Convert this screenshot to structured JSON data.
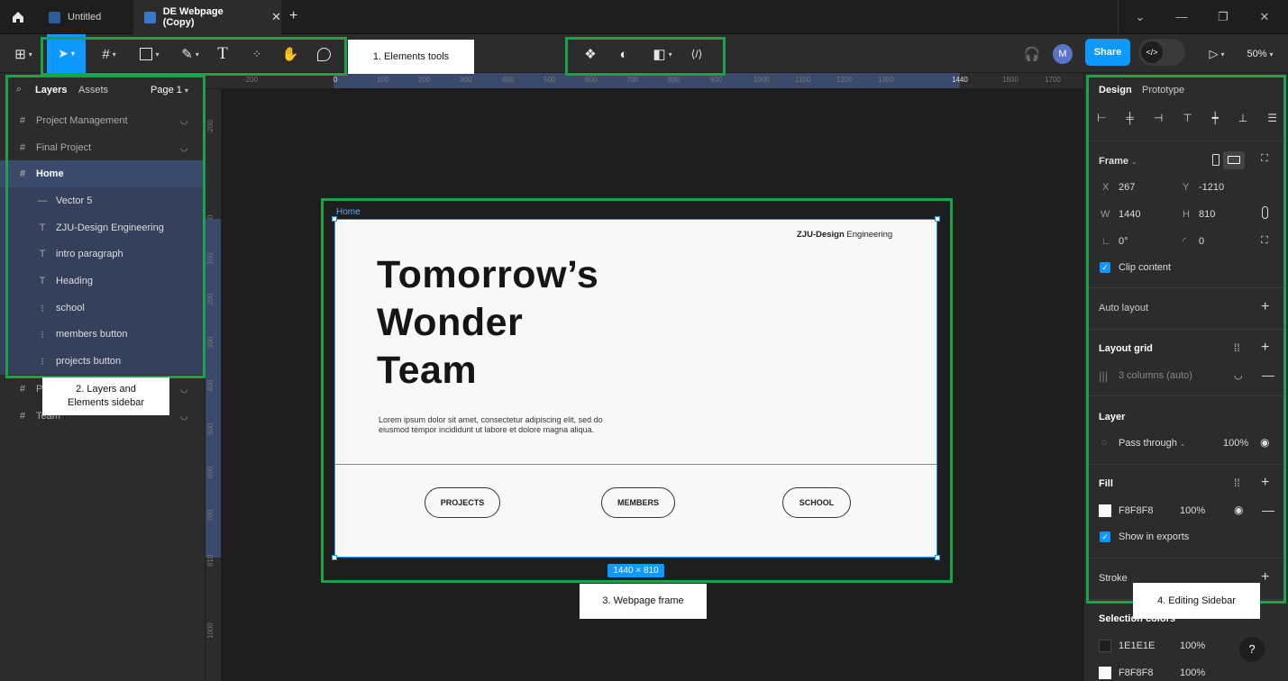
{
  "tabs": [
    {
      "label": "Untitled"
    },
    {
      "label": "DE Webpage (Copy)"
    }
  ],
  "toolbar": {
    "share": "Share",
    "zoom": "50%",
    "avatar_initial": "M",
    "text_tool": "T"
  },
  "left": {
    "tab_layers": "Layers",
    "tab_assets": "Assets",
    "page": "Page 1",
    "layers": [
      {
        "label": "Project Management",
        "icon": "#"
      },
      {
        "label": "Final Project",
        "icon": "#"
      },
      {
        "label": "Home",
        "icon": "#"
      },
      {
        "label": "Vector 5",
        "icon": "—"
      },
      {
        "label": "ZJU-Design Engineering",
        "icon": "T"
      },
      {
        "label": "intro paragraph",
        "icon": "T"
      },
      {
        "label": "Heading",
        "icon": "T"
      },
      {
        "label": "school",
        "icon": "⁝"
      },
      {
        "label": "members button",
        "icon": "⁝"
      },
      {
        "label": "projects button",
        "icon": "⁝"
      },
      {
        "label": "P",
        "icon": "#"
      },
      {
        "label": "Team",
        "icon": "#"
      }
    ]
  },
  "ruler": {
    "top": [
      "-200",
      "0",
      "100",
      "200",
      "300",
      "400",
      "500",
      "600",
      "700",
      "800",
      "900",
      "1000",
      "1100",
      "1200",
      "1300",
      "1440",
      "1600",
      "1700"
    ],
    "left": [
      "-200",
      "0",
      "100",
      "200",
      "300",
      "400",
      "500",
      "600",
      "700",
      "810",
      "1000"
    ]
  },
  "canvas": {
    "frame_label": "Home",
    "size_badge": "1440 × 810",
    "brand_bold": "ZJU-Design",
    "brand_rest": " Engineering",
    "hero": [
      "Tomorrow’s",
      "Wonder",
      "Team"
    ],
    "intro": "Lorem ipsum dolor sit amet, consectetur adipiscing elit, sed do eiusmod tempor incididunt ut labore et dolore magna aliqua.",
    "buttons": [
      "PROJECTS",
      "MEMBERS",
      "SCHOOL"
    ]
  },
  "right": {
    "tab_design": "Design",
    "tab_prototype": "Prototype",
    "frame_label": "Frame",
    "x_label": "X",
    "x": "267",
    "y_label": "Y",
    "y": "-1210",
    "w_label": "W",
    "w": "1440",
    "h_label": "H",
    "h": "810",
    "rotation": "0°",
    "radius": "0",
    "clip": "Clip content",
    "auto_layout": "Auto layout",
    "layout_grid": "Layout grid",
    "grid_value": "3 columns (auto)",
    "layer": "Layer",
    "blend": "Pass through",
    "layer_opacity": "100%",
    "fill": "Fill",
    "fill_hex": "F8F8F8",
    "fill_opacity": "100%",
    "show_exports": "Show in exports",
    "stroke": "Stroke",
    "selection_colors": "Selection colors",
    "sel": [
      {
        "hex": "1E1E1E",
        "pct": "100%",
        "color": "#1e1e1e"
      },
      {
        "hex": "F8F8F8",
        "pct": "100%",
        "color": "#f8f8f8"
      }
    ],
    "help": "?"
  },
  "notes": {
    "n1": "1. Elements tools",
    "n2a": "2. Layers and",
    "n2b": "Elements sidebar",
    "n3": "3. Webpage frame",
    "n4": "4. Editing Sidebar"
  },
  "colors": {
    "accent": "#0d99ff",
    "annotation": "#1aa34a",
    "page_bg": "#f8f8f8"
  }
}
